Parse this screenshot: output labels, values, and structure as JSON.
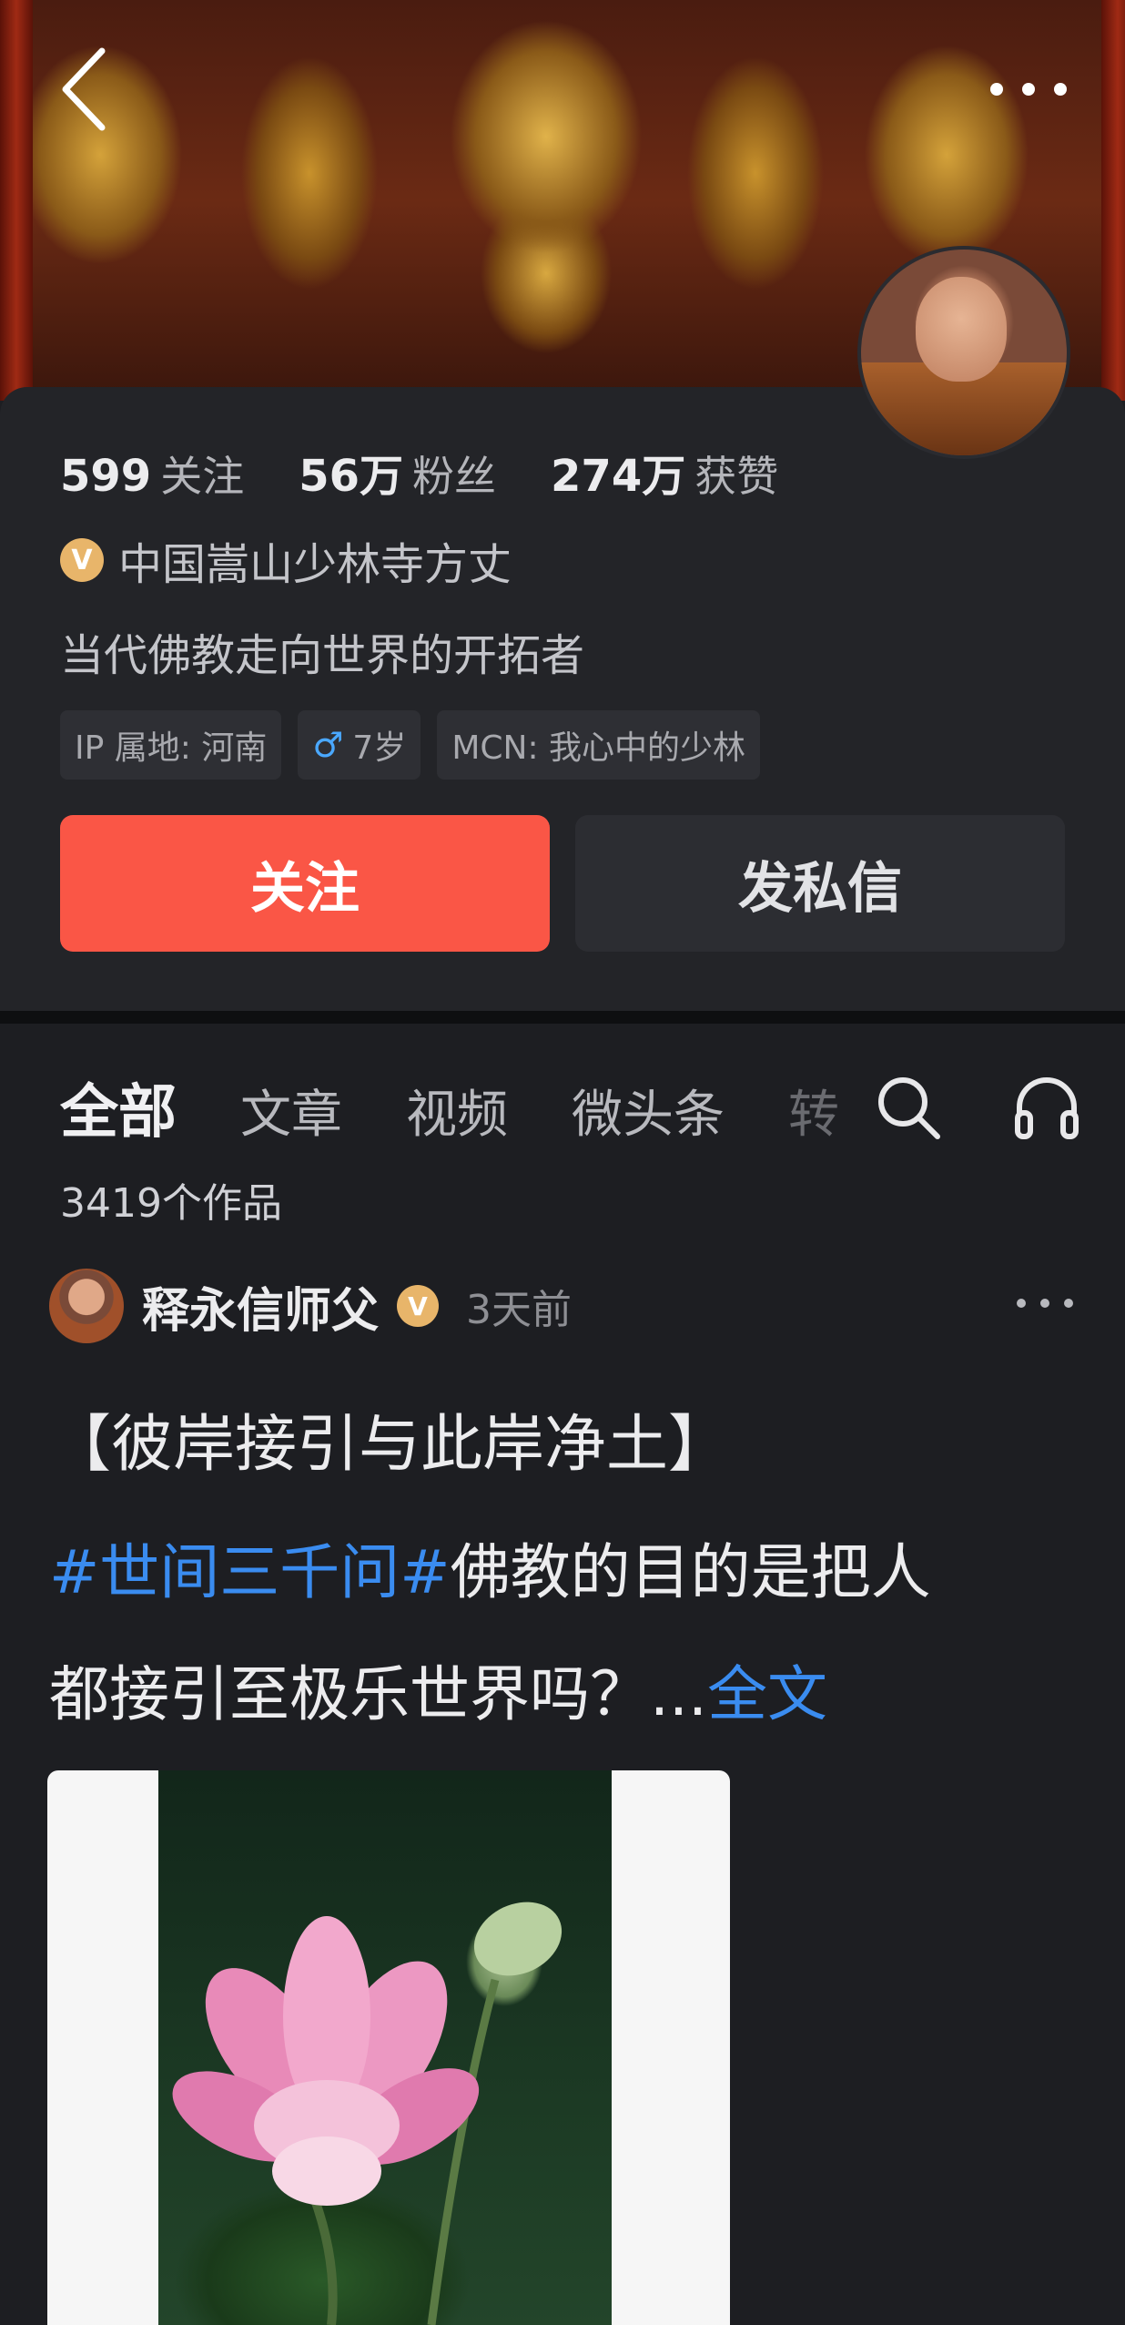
{
  "profile": {
    "stats": [
      {
        "num": "599",
        "label": "关注"
      },
      {
        "num": "56万",
        "label": "粉丝"
      },
      {
        "num": "274万",
        "label": "获赞"
      }
    ],
    "verified_badge": "V",
    "verified_title": "中国嵩山少林寺方丈",
    "bio": "当代佛教走向世界的开拓者",
    "tags": {
      "ip": "IP 属地: 河南",
      "gender_icon": "♂",
      "age": "7岁",
      "mcn": "MCN: 我心中的少林"
    },
    "follow_label": "关注",
    "message_label": "发私信"
  },
  "tabs": [
    {
      "label": "全部",
      "active": true
    },
    {
      "label": "文章"
    },
    {
      "label": "视频"
    },
    {
      "label": "微头条"
    },
    {
      "label": "转"
    }
  ],
  "works_count": "3419个作品",
  "post": {
    "author": "释永信师父",
    "badge": "V",
    "time": "3天前",
    "title": "【彼岸接引与此岸净土】",
    "hashtag": "#世间三千问#",
    "text_line1": "佛教的目的是把人",
    "text_line2": "都接引至极乐世界吗？...",
    "fulltext_link": "全文"
  },
  "colors": {
    "accent_red": "#fa5646",
    "link_blue": "#3a8cf0",
    "badge_gold": "#e8b56a",
    "background": "#1d1e22"
  },
  "icons": [
    "back-arrow-icon",
    "more-dots-icon",
    "search-icon",
    "headphones-icon",
    "gender-male-icon",
    "verified-icon"
  ]
}
